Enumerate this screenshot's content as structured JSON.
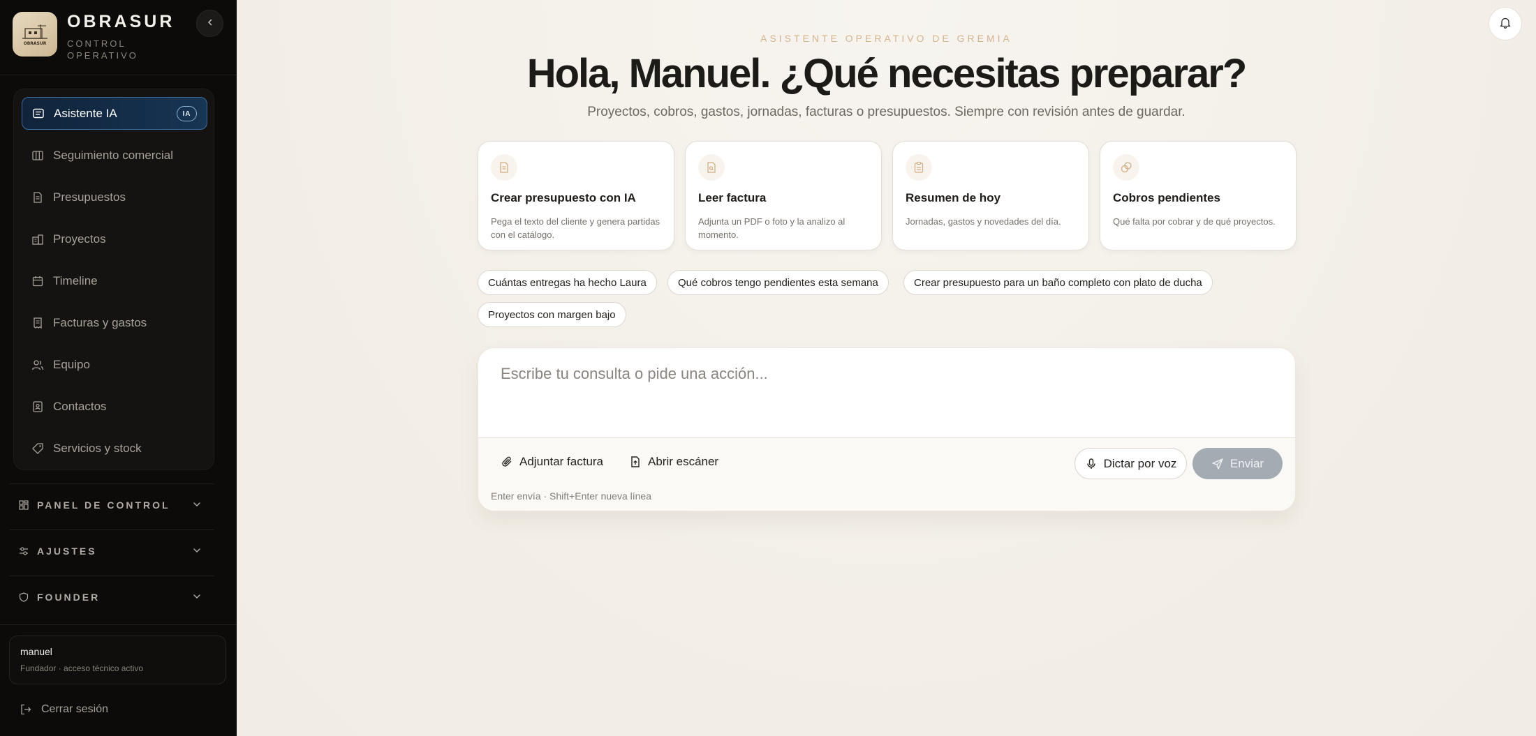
{
  "brand": {
    "name": "OBRASUR",
    "subtitle_line1": "CONTROL",
    "subtitle_line2": "OPERATIVO",
    "logo_text": "OBRASUR"
  },
  "sidebar": {
    "items": [
      {
        "label": "Asistente IA",
        "icon": "chat-icon",
        "badge": "IA",
        "active": true
      },
      {
        "label": "Seguimiento comercial",
        "icon": "kanban-icon"
      },
      {
        "label": "Presupuestos",
        "icon": "document-icon"
      },
      {
        "label": "Proyectos",
        "icon": "building-icon"
      },
      {
        "label": "Timeline",
        "icon": "calendar-icon"
      },
      {
        "label": "Facturas y gastos",
        "icon": "receipt-icon"
      },
      {
        "label": "Equipo",
        "icon": "users-icon"
      },
      {
        "label": "Contactos",
        "icon": "contact-icon"
      },
      {
        "label": "Servicios y stock",
        "icon": "tag-icon"
      }
    ],
    "sections": [
      {
        "label": "PANEL DE CONTROL",
        "icon": "grid-icon"
      },
      {
        "label": "AJUSTES",
        "icon": "sliders-icon"
      },
      {
        "label": "FOUNDER",
        "icon": "shield-icon"
      }
    ],
    "user": {
      "name": "manuel",
      "role": "Fundador · acceso técnico activo"
    },
    "logout_label": "Cerrar sesión"
  },
  "main": {
    "kicker": "ASISTENTE OPERATIVO DE GREMIA",
    "headline": "Hola, Manuel. ¿Qué necesitas preparar?",
    "subline": "Proyectos, cobros, gastos, jornadas, facturas o presupuestos. Siempre con revisión antes de guardar.",
    "cards": [
      {
        "title": "Crear presupuesto con IA",
        "desc": "Pega el texto del cliente y genera partidas con el catálogo.",
        "icon": "document-icon"
      },
      {
        "title": "Leer factura",
        "desc": "Adjunta un PDF o foto y la analizo al momento.",
        "icon": "file-search-icon"
      },
      {
        "title": "Resumen de hoy",
        "desc": "Jornadas, gastos y novedades del día.",
        "icon": "clipboard-icon"
      },
      {
        "title": "Cobros pendientes",
        "desc": "Qué falta por cobrar y de qué proyectos.",
        "icon": "coins-icon"
      }
    ],
    "chips": [
      "Cuántas entregas ha hecho Laura",
      "Qué cobros tengo pendientes esta semana",
      "Crear presupuesto para un baño completo con plato de ducha",
      "Proyectos con margen bajo"
    ],
    "composer": {
      "placeholder": "Escribe tu consulta o pide una acción...",
      "attach_label": "Adjuntar factura",
      "scan_label": "Abrir escáner",
      "dictate_label": "Dictar por voz",
      "send_label": "Enviar",
      "hint": "Enter envía · Shift+Enter nueva línea"
    }
  },
  "colors": {
    "sidebar_bg": "#0c0b0a",
    "main_bg": "#f5f2ec",
    "accent": "#d4b48d",
    "active_nav": "#173554",
    "send_disabled": "#a4abb2"
  }
}
